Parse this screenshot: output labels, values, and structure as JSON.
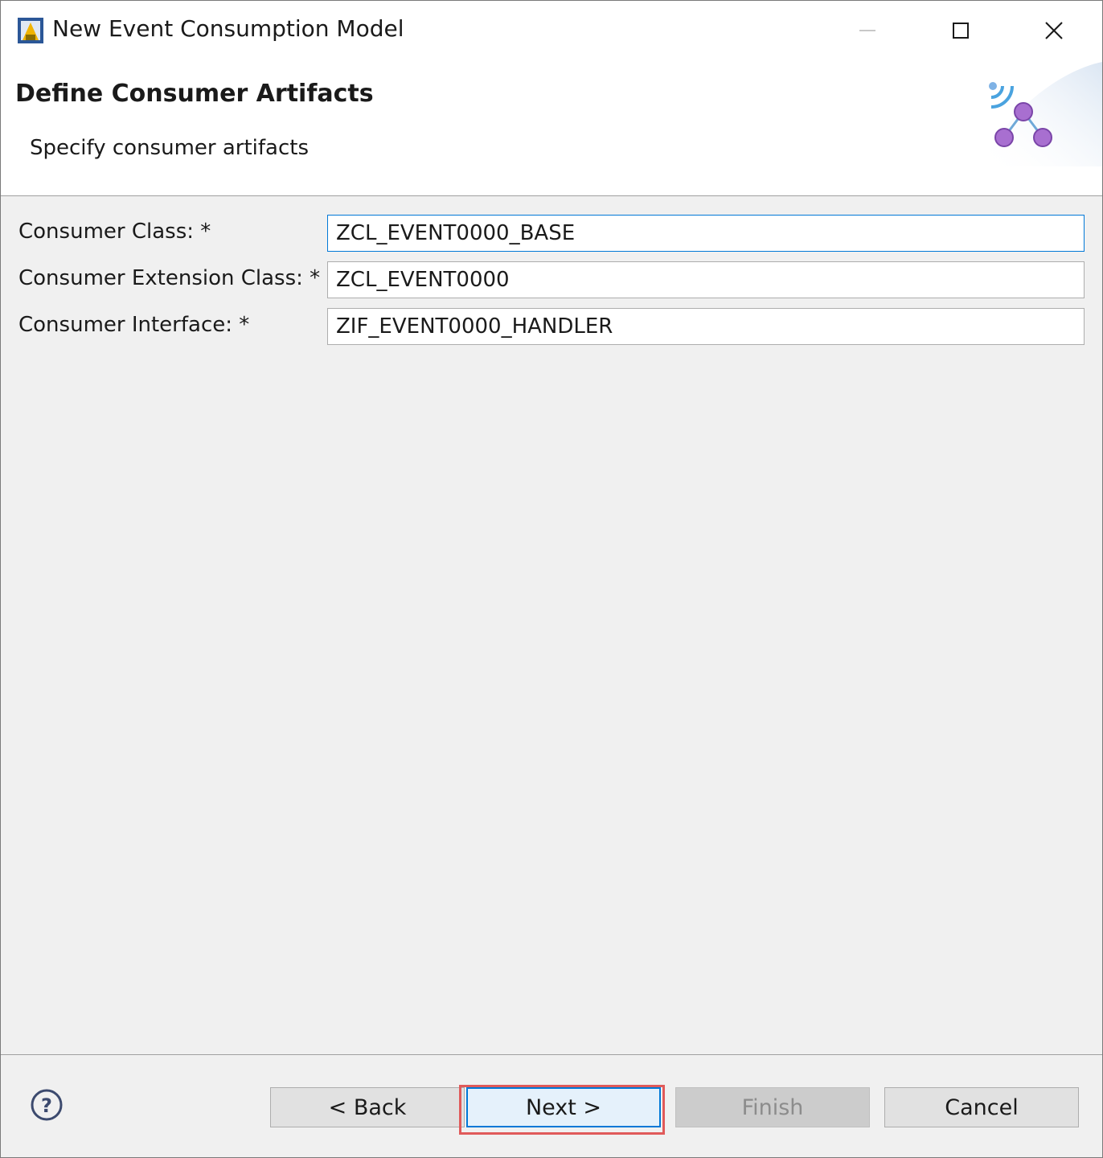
{
  "window": {
    "title": "New Event Consumption Model",
    "app_icon": "eclipse-app-icon",
    "controls": [
      "minimize-icon",
      "maximize-icon",
      "close-icon"
    ]
  },
  "header": {
    "title": "Define Consumer Artifacts",
    "description": "Specify consumer artifacts",
    "graphic": "event-network-icon"
  },
  "form": {
    "fields": [
      {
        "label": "Consumer Class: *",
        "value": "ZCL_EVENT0000_BASE",
        "focused": true
      },
      {
        "label": "Consumer Extension Class: *",
        "value": "ZCL_EVENT0000",
        "focused": false
      },
      {
        "label": "Consumer Interface: *",
        "value": "ZIF_EVENT0000_HANDLER",
        "focused": false
      }
    ]
  },
  "footer": {
    "help_icon": "help-icon",
    "back_label": "< Back",
    "next_label": "Next >",
    "finish_label": "Finish",
    "cancel_label": "Cancel",
    "finish_enabled": false,
    "highlighted_button": "Next >",
    "highlight_color": "#e05a5a",
    "accent_color": "#0078d7"
  }
}
